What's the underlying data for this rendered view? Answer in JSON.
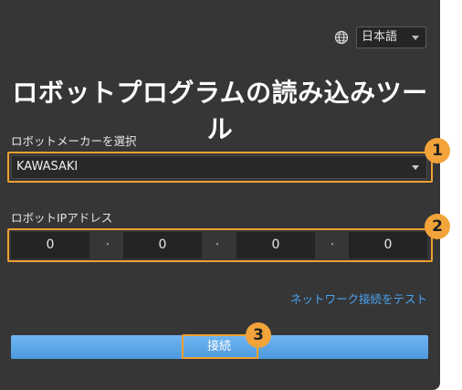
{
  "language": {
    "icon": "globe-icon",
    "selected": "日本語"
  },
  "title": "ロボットプログラムの読み込みツール",
  "maker": {
    "label": "ロボットメーカーを選択",
    "selected": "KAWASAKI"
  },
  "ip": {
    "label": "ロボットIPアドレス",
    "octets": [
      "0",
      "0",
      "0",
      "0"
    ],
    "separator": "·"
  },
  "test_link": "ネットワーク接続をテスト",
  "connect_button": "接続",
  "callouts": [
    "1",
    "2",
    "3"
  ],
  "colors": {
    "panel": "#363637",
    "accent": "#f2a33a",
    "link": "#4aa3f0",
    "button": "#5aa5e6"
  }
}
